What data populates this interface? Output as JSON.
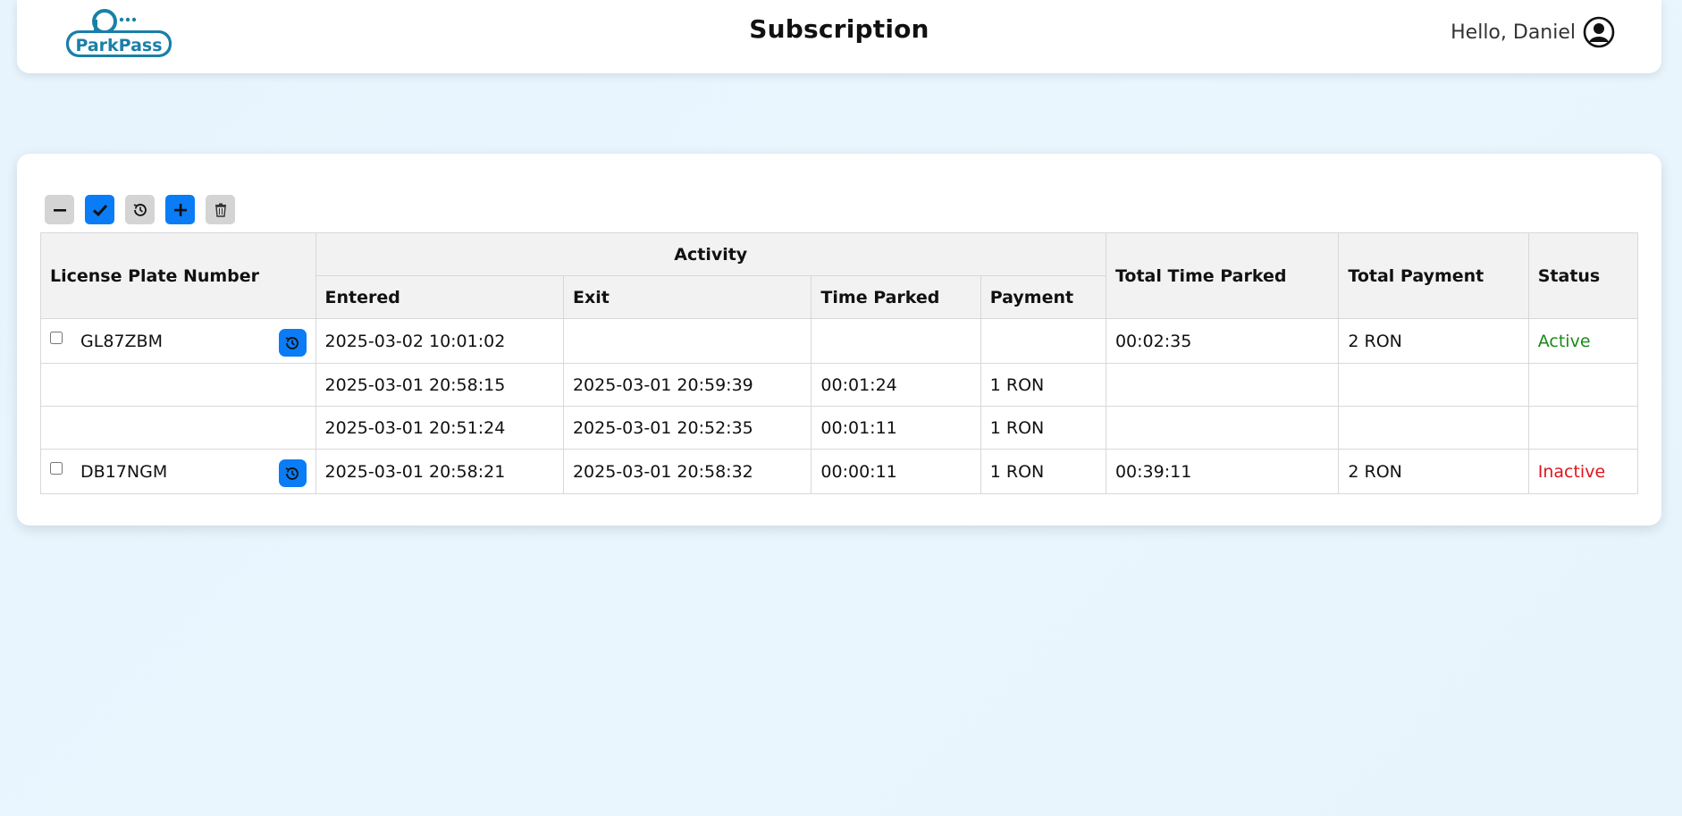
{
  "header": {
    "logo_text": "ParkPass",
    "title": "Subscription",
    "greeting": "Hello, Daniel"
  },
  "toolbar": {
    "buttons": [
      {
        "icon": "minus-icon",
        "color": "#d4d4d4"
      },
      {
        "icon": "check-icon",
        "color": "#0a7cf5"
      },
      {
        "icon": "history-icon",
        "color": "#d4d4d4"
      },
      {
        "icon": "plus-icon",
        "color": "#0a7cf5"
      },
      {
        "icon": "trash-icon",
        "color": "#d4d4d4"
      }
    ]
  },
  "table": {
    "headers": {
      "plate": "License Plate Number",
      "activity": "Activity",
      "entered": "Entered",
      "exit": "Exit",
      "time_parked": "Time Parked",
      "payment": "Payment",
      "total_time": "Total Time Parked",
      "total_payment": "Total Payment",
      "status": "Status"
    },
    "rows": [
      {
        "plate": "GL87ZBM",
        "entered": "2025-03-02 10:01:02",
        "exit": "",
        "time_parked": "",
        "payment": "",
        "total_time": "00:02:35",
        "total_payment": "2 RON",
        "status": "Active"
      },
      {
        "plate": "",
        "entered": "2025-03-01 20:58:15",
        "exit": "2025-03-01 20:59:39",
        "time_parked": "00:01:24",
        "payment": "1 RON",
        "total_time": "",
        "total_payment": "",
        "status": ""
      },
      {
        "plate": "",
        "entered": "2025-03-01 20:51:24",
        "exit": "2025-03-01 20:52:35",
        "time_parked": "00:01:11",
        "payment": "1 RON",
        "total_time": "",
        "total_payment": "",
        "status": ""
      },
      {
        "plate": "DB17NGM",
        "entered": "2025-03-01 20:58:21",
        "exit": "2025-03-01 20:58:32",
        "time_parked": "00:00:11",
        "payment": "1 RON",
        "total_time": "00:39:11",
        "total_payment": "2 RON",
        "status": "Inactive"
      }
    ]
  },
  "colors": {
    "accent": "#0a7cf5",
    "active": "#1a8a1a",
    "inactive": "#e0141b",
    "logo": "#1a7fa8"
  }
}
